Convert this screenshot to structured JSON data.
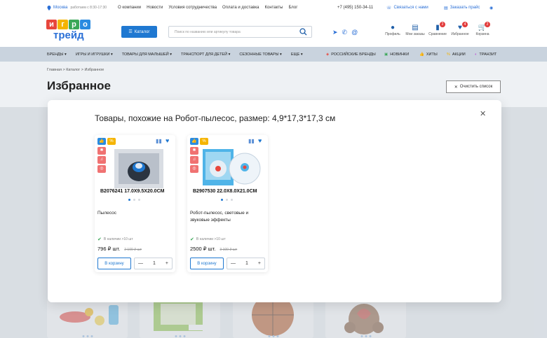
{
  "topbar": {
    "city": "Москва",
    "hours": "работаем с 8:30-17:30",
    "nav": [
      "О компании",
      "Новости",
      "Условия сотрудничества",
      "Оплата и доставка",
      "Контакты",
      "Блог"
    ],
    "phone": "+7 (495) 150-34-11",
    "contact": "Связаться с нами",
    "price_list": "Заказать прайс"
  },
  "header": {
    "logo_letters": [
      "и",
      "г",
      "р",
      "о"
    ],
    "logo_brand": "трейд",
    "catalog_label": "Каталог",
    "search_placeholder": "Поиск по названию или артикулу товара",
    "icons": [
      {
        "label": "Профиль",
        "icon": "user-icon",
        "badge": ""
      },
      {
        "label": "Мои заказы",
        "icon": "orders-icon",
        "badge": ""
      },
      {
        "label": "Сравнение",
        "icon": "compare-icon",
        "badge": "2"
      },
      {
        "label": "Избранное",
        "icon": "heart-icon",
        "badge": "4"
      },
      {
        "label": "Корзина",
        "icon": "cart-icon",
        "badge": "2"
      }
    ]
  },
  "mainnav": {
    "items": [
      "БРЕНДЫ",
      "ИГРЫ И ИГРУШКИ",
      "ТОВАРЫ ДЛЯ МАЛЫШЕЙ",
      "ТРАНСПОРТ ДЛЯ ДЕТЕЙ",
      "СЕЗОННЫЕ ТОВАРЫ",
      "ЕЩЕ"
    ],
    "right_items": [
      "РОССИЙСКИЕ БРЕНДЫ",
      "НОВИНКИ",
      "ХИТЫ",
      "АКЦИИ",
      "ТРАНЗИТ"
    ]
  },
  "breadcrumb": "Главная  >  Каталог  >  Избранное",
  "page_title": "Избранное",
  "clear_label": "Очистить список",
  "modal": {
    "title": "Товары, похожие на Робот-пылесос, размер: 4,9*17,3*17,3 см",
    "cards": [
      {
        "code": "B2076241    17.0X9.5X20.0CM",
        "name": "Пылесос",
        "stock": "В наличии >10 шт",
        "price": "796 ₽ шт.",
        "old_price": "2 100 ₽ шт",
        "cart_label": "В корзину",
        "qty": "1"
      },
      {
        "code": "B2907530    22.0X8.0X21.0CM",
        "name": "Робот-пылесос, световые и звуковые эффекты",
        "stock": "В наличии >10 шт",
        "price": "2500 ₽ шт.",
        "old_price": "3 100 ₽ шт",
        "cart_label": "В корзину",
        "qty": "1"
      }
    ]
  },
  "colors": {
    "accent": "#1f78d1",
    "badge_blue": "#2a8be0",
    "badge_yellow": "#f5b400",
    "badge_red": "#f07272"
  }
}
